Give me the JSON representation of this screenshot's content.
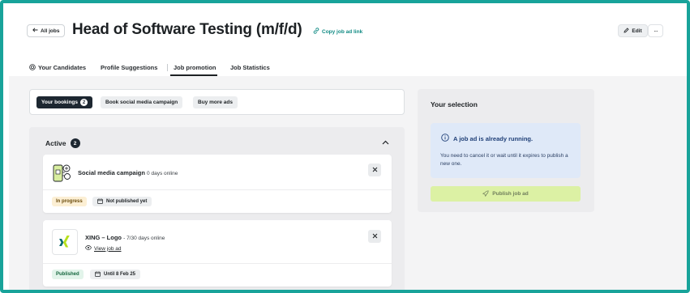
{
  "header": {
    "back_label": "All jobs",
    "title": "Head of Software Testing (m/f/d)",
    "copy_link_label": "Copy job ad link",
    "edit_label": "Edit",
    "more_label": "···"
  },
  "tabs": [
    {
      "label": "Your Candidates"
    },
    {
      "label": "Profile Suggestions"
    },
    {
      "label": "Job promotion"
    },
    {
      "label": "Job Statistics"
    }
  ],
  "bookings_bar": {
    "your_bookings_label": "Your bookings",
    "your_bookings_count": "2",
    "social_campaign_label": "Book social media campaign",
    "buy_more_label": "Buy more ads"
  },
  "active_section": {
    "title": "Active",
    "count": "2",
    "cards": [
      {
        "name": "Social media campaign",
        "meta": "0 days online",
        "status": "In progress",
        "date": "Not published yet"
      },
      {
        "name": "XING – Logo",
        "meta": "- 7/30 days online",
        "view_link": "View job ad",
        "status": "Published",
        "date": "Until 8 Feb 25"
      }
    ]
  },
  "selection": {
    "title": "Your selection",
    "info_title": "A job ad is already running.",
    "info_text": "You need to cancel it or wait until it expires to publish a new one.",
    "publish_label": "Publish job ad"
  },
  "colors": {
    "frame": "#18a39a",
    "accent_link": "#0f8a83",
    "dark_pill": "#1d2731",
    "info_bg": "#dfe9f8",
    "publish_bg": "#dcf1a4",
    "xing_green": "#b7df1b",
    "xing_teal": "#0a6b6f"
  }
}
